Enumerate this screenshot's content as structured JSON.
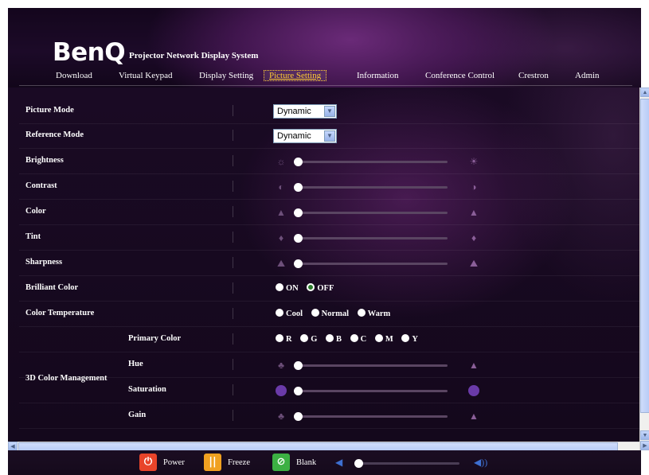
{
  "header": {
    "logo": "BenQ",
    "system_title": "Projector Network Display System"
  },
  "nav": [
    {
      "label": "Download",
      "active": false
    },
    {
      "label": "Virtual Keypad",
      "active": false
    },
    {
      "label": "Display Setting",
      "active": false
    },
    {
      "label": "Picture Setting",
      "active": true
    },
    {
      "label": "Information",
      "active": false
    },
    {
      "label": "Conference Control",
      "active": false
    },
    {
      "label": "Crestron",
      "active": false
    },
    {
      "label": "Admin",
      "active": false
    }
  ],
  "settings": {
    "picture_mode": {
      "label": "Picture Mode",
      "value": "Dynamic"
    },
    "reference_mode": {
      "label": "Reference Mode",
      "value": "Dynamic"
    },
    "brightness": {
      "label": "Brightness",
      "level": 0
    },
    "contrast": {
      "label": "Contrast",
      "level": 0
    },
    "color": {
      "label": "Color",
      "level": 0
    },
    "tint": {
      "label": "Tint",
      "level": 0
    },
    "sharpness": {
      "label": "Sharpness",
      "level": 0
    },
    "brilliant_color": {
      "label": "Brilliant Color",
      "options": [
        "ON",
        "OFF"
      ],
      "selected": "OFF"
    },
    "color_temperature": {
      "label": "Color Temperature",
      "options": [
        "Cool",
        "Normal",
        "Warm"
      ],
      "selected": null
    },
    "color_management": {
      "label": "3D Color Management",
      "primary_color": {
        "label": "Primary Color",
        "options": [
          "R",
          "G",
          "B",
          "C",
          "M",
          "Y"
        ],
        "selected": null
      },
      "hue": {
        "label": "Hue",
        "level": 0
      },
      "saturation": {
        "label": "Saturation",
        "level": 0
      },
      "gain": {
        "label": "Gain",
        "level": 0
      }
    }
  },
  "footer": {
    "power_label": "Power",
    "freeze_label": "Freeze",
    "blank_label": "Blank",
    "volume_level": 0
  },
  "colors": {
    "power": "#e8442a",
    "freeze": "#f0a020",
    "blank": "#3cb043",
    "active_nav": "#ffcc33",
    "volume_icon": "#3d6fd0"
  }
}
